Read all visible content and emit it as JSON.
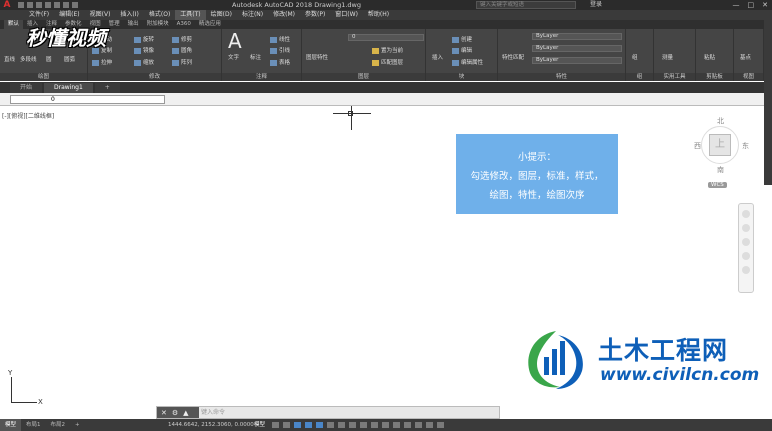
{
  "app": {
    "logo": "A",
    "title": "Autodesk AutoCAD 2018    Drawing1.dwg",
    "search_placeholder": "键入关键字或短语",
    "login": "登录",
    "window_buttons": [
      "—",
      "□",
      "✕"
    ]
  },
  "menubar": [
    {
      "label": "文件(F)"
    },
    {
      "label": "编辑(E)"
    },
    {
      "label": "视图(V)"
    },
    {
      "label": "插入(I)"
    },
    {
      "label": "格式(O)"
    },
    {
      "label": "工具(T)",
      "active": true
    },
    {
      "label": "绘图(D)"
    },
    {
      "label": "标注(N)"
    },
    {
      "label": "修改(M)"
    },
    {
      "label": "参数(P)"
    },
    {
      "label": "窗口(W)"
    },
    {
      "label": "帮助(H)"
    }
  ],
  "ribbon_tabs": [
    "默认",
    "插入",
    "注释",
    "参数化",
    "视图",
    "管理",
    "输出",
    "附加模块",
    "A360",
    "精选应用"
  ],
  "ribbon": {
    "draw": {
      "label": "绘图",
      "buttons": [
        "直线",
        "多段线",
        "圆",
        "圆弧"
      ]
    },
    "modify": {
      "label": "修改",
      "buttons": [
        "移动",
        "旋转",
        "修剪",
        "复制",
        "镜像",
        "圆角",
        "拉伸",
        "缩放",
        "阵列"
      ]
    },
    "annotation": {
      "label": "注释",
      "buttons": [
        "文字",
        "标注",
        "线性",
        "引线",
        "表格"
      ]
    },
    "layers": {
      "label": "图层",
      "buttons": [
        "图层特性",
        "置为当前",
        "匹配图层"
      ],
      "current_layer": "0"
    },
    "block": {
      "label": "块",
      "buttons": [
        "插入",
        "创建",
        "编辑",
        "编辑属性"
      ]
    },
    "properties": {
      "label": "特性",
      "buttons": [
        "特性匹配"
      ],
      "color": "ByLayer",
      "linetype": "ByLayer",
      "lineweight": "ByLayer"
    },
    "groups": {
      "label": "组",
      "buttons": [
        "组"
      ]
    },
    "utilities": {
      "label": "实用工具",
      "buttons": [
        "测量"
      ]
    },
    "clipboard": {
      "label": "剪贴板",
      "buttons": [
        "粘贴"
      ]
    },
    "view": {
      "label": "视图",
      "buttons": [
        "基点"
      ]
    }
  },
  "watermark": "秒懂视频",
  "file_tabs": [
    "开始",
    "Drawing1"
  ],
  "add_tab": "+",
  "layer_bar": {
    "current": "0"
  },
  "viewport_label": "[-][俯视][二维线框]",
  "tip": {
    "title": "小提示：",
    "line1": "勾选修改，图层，标准，样式，",
    "line2": "绘图，特性，绘图次序"
  },
  "viewcube": {
    "north": "北",
    "south": "南",
    "east": "东",
    "west": "西",
    "face": "上",
    "wcs": "WCS"
  },
  "ucs": {
    "x": "X",
    "y": "Y"
  },
  "site_logo": {
    "name": "土木工程网",
    "url": "www.civilcn.com",
    "colors": {
      "blue": "#0e5fb8",
      "green": "#3aa64a"
    }
  },
  "command_line": {
    "placeholder": "键入命令"
  },
  "status": {
    "layouts": [
      "模型",
      "布局1",
      "布局2"
    ],
    "add_layout": "+",
    "coords": "1444.6642, 2152.3060, 0.0000",
    "model": "模型"
  },
  "colors": {
    "accent": "#4a86c8",
    "tip_bg": "#6fb0ea",
    "dark_ui": "#3a3a3a"
  }
}
